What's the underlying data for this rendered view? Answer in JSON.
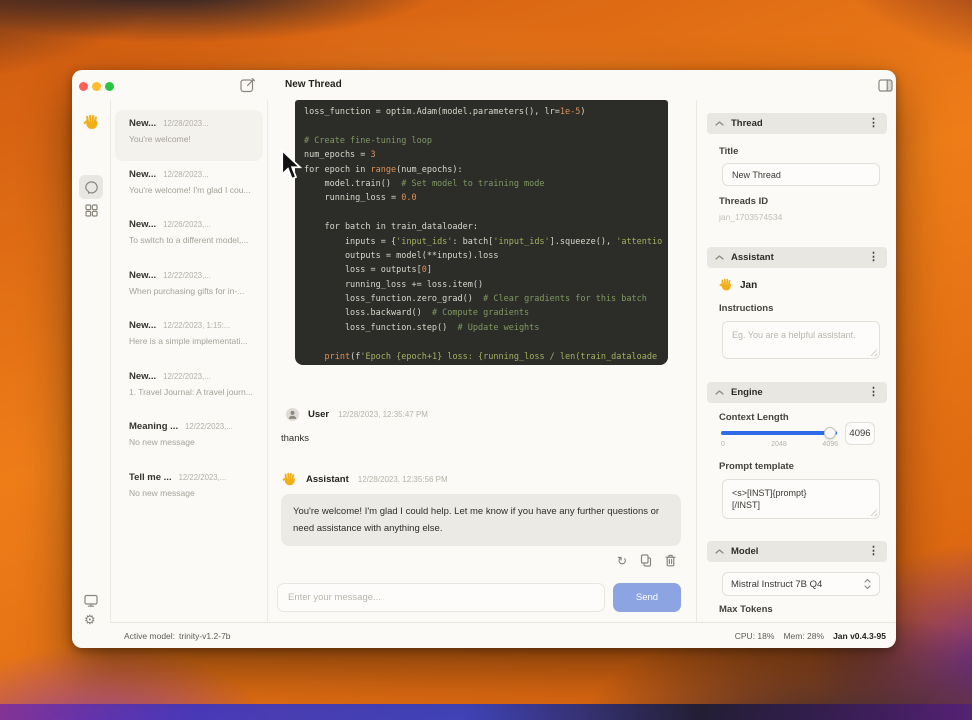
{
  "titlebar": {
    "title": "New Thread"
  },
  "sidebar": {
    "threads": [
      {
        "title": "New...",
        "date": "12/28/2023...",
        "subtitle": "You're welcome!"
      },
      {
        "title": "New...",
        "date": "12/28/2023...",
        "subtitle": "You're welcome! I'm glad I cou..."
      },
      {
        "title": "New...",
        "date": "12/26/2023,...",
        "subtitle": "To switch to a different model,..."
      },
      {
        "title": "New...",
        "date": "12/22/2023,...",
        "subtitle": "When purchasing gifts for in-..."
      },
      {
        "title": "New...",
        "date": "12/22/2023, 1:15:...",
        "subtitle": "Here is a simple implementati..."
      },
      {
        "title": "New...",
        "date": "12/22/2023,...",
        "subtitle": "1. Travel Journal: A travel journ..."
      },
      {
        "title": "Meaning ...",
        "date": "12/22/2023,...",
        "subtitle": "No new message"
      },
      {
        "title": "Tell me ...",
        "date": "12/22/2023,...",
        "subtitle": "No new message"
      }
    ]
  },
  "chat": {
    "code": {
      "lines": [
        [
          [
            "d",
            "loss_function = optim.Adam(model.parameters(), lr="
          ],
          [
            "n",
            "1e-5"
          ],
          [
            "d",
            ")"
          ]
        ],
        [],
        [
          [
            "c",
            "# Create fine-tuning loop"
          ]
        ],
        [
          [
            "d",
            "num_epochs = "
          ],
          [
            "n",
            "3"
          ]
        ],
        [
          [
            "d",
            "for epoch in "
          ],
          [
            "n",
            "range"
          ],
          [
            "d",
            "(num_epochs):"
          ]
        ],
        [
          [
            "d",
            "    model.train()  "
          ],
          [
            "c",
            "# Set model to training mode"
          ]
        ],
        [
          [
            "d",
            "    running_loss = "
          ],
          [
            "n",
            "0.0"
          ]
        ],
        [],
        [
          [
            "d",
            "    for batch in train_dataloader:"
          ]
        ],
        [
          [
            "d",
            "        inputs = {"
          ],
          [
            "s",
            "'input_ids'"
          ],
          [
            "d",
            ": batch["
          ],
          [
            "s",
            "'input_ids'"
          ],
          [
            "d",
            "].squeeze(), "
          ],
          [
            "s",
            "'attentio"
          ]
        ],
        [
          [
            "d",
            "        outputs = model(**inputs).loss"
          ]
        ],
        [
          [
            "d",
            "        loss = outputs["
          ],
          [
            "n",
            "0"
          ],
          [
            "d",
            "]"
          ]
        ],
        [
          [
            "d",
            "        running_loss += loss.item()"
          ]
        ],
        [
          [
            "d",
            "        loss_function.zero_grad()  "
          ],
          [
            "c",
            "# Clear gradients for this batch"
          ]
        ],
        [
          [
            "d",
            "        loss.backward()  "
          ],
          [
            "c",
            "# Compute gradients"
          ]
        ],
        [
          [
            "d",
            "        loss_function.step()  "
          ],
          [
            "c",
            "# Update weights"
          ]
        ],
        [],
        [
          [
            "d",
            "    "
          ],
          [
            "n",
            "print"
          ],
          [
            "d",
            "(f"
          ],
          [
            "s",
            "'Epoch {epoch+1} loss: {running_loss / len(train_dataloade"
          ]
        ]
      ]
    },
    "user_message": {
      "name": "User",
      "time": "12/28/2023, 12:35:47 PM",
      "text": "thanks"
    },
    "assistant_message": {
      "name": "Assistant",
      "time": "12/28/2023, 12:35:56 PM",
      "text": "You're welcome! I'm glad I could help. Let me know if you have any further questions or need assistance with anything else."
    },
    "input": {
      "placeholder": "Enter your message...",
      "send_label": "Send"
    }
  },
  "panel": {
    "thread": {
      "header": "Thread",
      "title_label": "Title",
      "title_value": "New Thread",
      "id_label": "Threads ID",
      "id_value": "jan_1703574534"
    },
    "assistant": {
      "header": "Assistant",
      "name": "Jan",
      "instructions_label": "Instructions",
      "instructions_placeholder": "Eg. You are a helpful assistant."
    },
    "engine": {
      "header": "Engine",
      "context_label": "Context Length",
      "context_value": "4096",
      "ticks": {
        "min": "0",
        "mid": "2048",
        "max": "4096"
      },
      "prompt_label": "Prompt template",
      "prompt_value": "<s>[INST]{prompt}\n[/INST]"
    },
    "model": {
      "header": "Model",
      "selected": "Mistral Instruct 7B Q4",
      "max_tokens_label": "Max Tokens"
    }
  },
  "statusbar": {
    "active_label": "Active model:",
    "active_value": "trinity-v1.2-7b",
    "cpu": "CPU: 18%",
    "mem": "Mem: 28%",
    "version": "Jan v0.4.3-95"
  },
  "colors": {
    "accent_slider": "#2e6be5",
    "send_button": "#8ca4e2",
    "code_background": "#2c2c29",
    "code_comment": "#7f9a60",
    "code_string": "#a3b15e",
    "code_number": "#dd9255",
    "hand_logo": "#f2ae19"
  },
  "icons": {
    "compose": "pencil-square",
    "panel_toggle": "sidebar-right",
    "rail_threads": "chat-bubble",
    "rail_hub": "grid-squares",
    "rail_system": "monitor",
    "rail_settings": "gear",
    "actions": [
      "regenerate",
      "copy",
      "trash"
    ],
    "section_menu": "kebab-vertical-dots"
  }
}
